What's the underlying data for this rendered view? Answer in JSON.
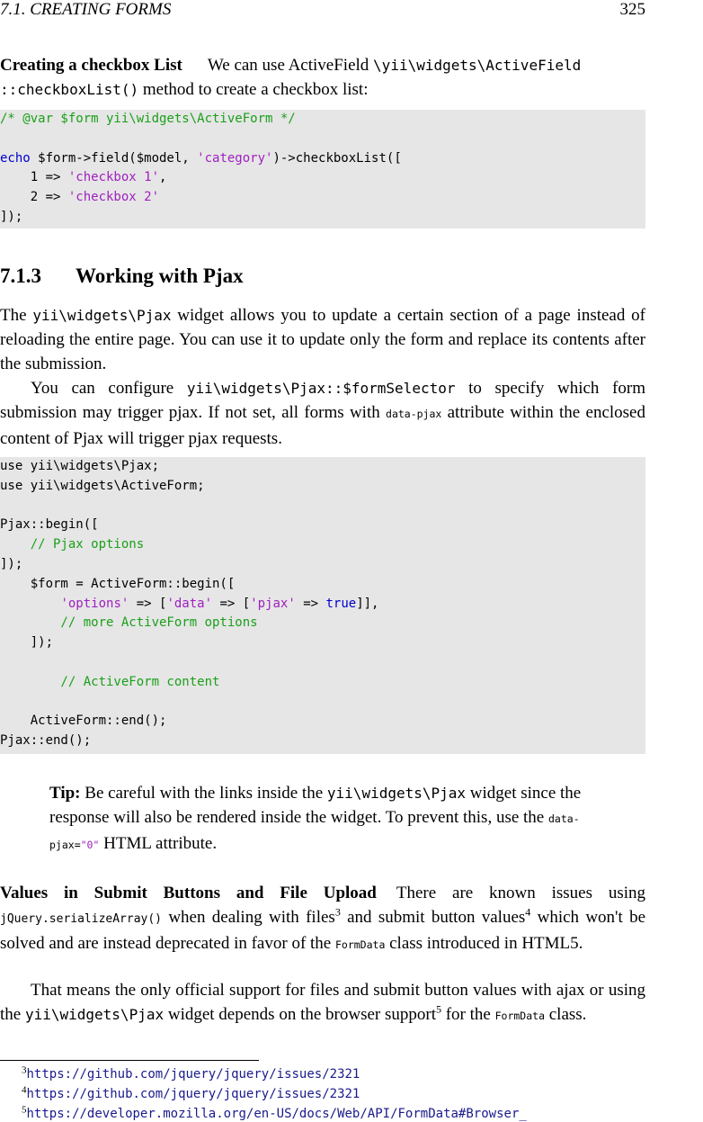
{
  "header": {
    "chapter": "7.1.   CREATING FORMS",
    "page_number": "325"
  },
  "section_checkbox": {
    "title": "Creating a checkbox List",
    "text_1": "We can use ActiveField ",
    "code_1": "\\yii\\widgets\\ActiveField",
    "code_2": "::checkboxList()",
    "text_2": " method to create a checkbox list:"
  },
  "code_block_1": {
    "lines": [
      {
        "parts": [
          {
            "t": "/* @var $form yii\\widgets\\ActiveForm */",
            "c": "cm"
          }
        ]
      },
      {
        "parts": [
          {
            "t": "",
            "c": ""
          }
        ]
      },
      {
        "parts": [
          {
            "t": "echo",
            "c": "kw"
          },
          {
            "t": " $form->field($model, ",
            "c": ""
          },
          {
            "t": "'category'",
            "c": "str"
          },
          {
            "t": ")->checkboxList([",
            "c": ""
          }
        ]
      },
      {
        "parts": [
          {
            "t": "    1 => ",
            "c": ""
          },
          {
            "t": "'checkbox 1'",
            "c": "str"
          },
          {
            "t": ",",
            "c": ""
          }
        ]
      },
      {
        "parts": [
          {
            "t": "    2 => ",
            "c": ""
          },
          {
            "t": "'checkbox 2'",
            "c": "str"
          }
        ]
      },
      {
        "parts": [
          {
            "t": "]);",
            "c": ""
          }
        ]
      }
    ]
  },
  "section_pjax": {
    "number": "7.1.3",
    "title": "Working with Pjax",
    "p1_a": "The ",
    "p1_code": "yii\\widgets\\Pjax",
    "p1_b": " widget allows you to update a certain section of a page instead of reloading the entire page. You can use it to update only the form and replace its contents after the submission.",
    "p2_a": "You can configure ",
    "p2_code": "yii\\widgets\\Pjax::$formSelector",
    "p2_b": " to specify which form submission may trigger pjax. If not set, all forms with ",
    "p2_code2": "data-pjax",
    "p2_c": " attribute within the enclosed content of Pjax will trigger pjax requests."
  },
  "code_block_2": {
    "lines": [
      {
        "parts": [
          {
            "t": "use yii\\widgets\\Pjax;",
            "c": ""
          }
        ]
      },
      {
        "parts": [
          {
            "t": "use yii\\widgets\\ActiveForm;",
            "c": ""
          }
        ]
      },
      {
        "parts": [
          {
            "t": "",
            "c": ""
          }
        ]
      },
      {
        "parts": [
          {
            "t": "Pjax::begin([",
            "c": ""
          }
        ]
      },
      {
        "parts": [
          {
            "t": "    // Pjax options",
            "c": "cm"
          }
        ]
      },
      {
        "parts": [
          {
            "t": "]);",
            "c": ""
          }
        ]
      },
      {
        "parts": [
          {
            "t": "    $form = ActiveForm::begin([",
            "c": ""
          }
        ]
      },
      {
        "parts": [
          {
            "t": "        ",
            "c": ""
          },
          {
            "t": "'options'",
            "c": "str"
          },
          {
            "t": " => [",
            "c": ""
          },
          {
            "t": "'data'",
            "c": "str"
          },
          {
            "t": " => [",
            "c": ""
          },
          {
            "t": "'pjax'",
            "c": "str"
          },
          {
            "t": " => ",
            "c": ""
          },
          {
            "t": "true",
            "c": "kw"
          },
          {
            "t": "]],",
            "c": ""
          }
        ]
      },
      {
        "parts": [
          {
            "t": "        // more ActiveForm options",
            "c": "cm"
          }
        ]
      },
      {
        "parts": [
          {
            "t": "    ]);",
            "c": ""
          }
        ]
      },
      {
        "parts": [
          {
            "t": "",
            "c": ""
          }
        ]
      },
      {
        "parts": [
          {
            "t": "        // ActiveForm content",
            "c": "cm"
          }
        ]
      },
      {
        "parts": [
          {
            "t": "",
            "c": ""
          }
        ]
      },
      {
        "parts": [
          {
            "t": "    ActiveForm::end();",
            "c": ""
          }
        ]
      },
      {
        "parts": [
          {
            "t": "Pjax::end();",
            "c": ""
          }
        ]
      }
    ]
  },
  "tip": {
    "label": "Tip:",
    "text_a": " Be careful with the links inside the ",
    "code": "yii\\widgets\\Pjax",
    "text_b": " widget since the response will also be rendered inside the widget. To prevent this, use the ",
    "code2": "data-pjax=",
    "code3": "\"0\"",
    "text_c": " HTML attribute."
  },
  "section_values": {
    "title": "Values in Submit Buttons and File Upload",
    "p1_a": "There are known issues using ",
    "p1_code": "jQuery.serializeArray()",
    "p1_b": " when dealing with files",
    "fn3": "3",
    "p1_c": " and submit button values",
    "fn4": "4",
    "p1_d": " which won't be solved and are instead deprecated in favor of the ",
    "p1_code2": "FormData",
    "p1_e": " class introduced in HTML5.",
    "p2_a": "That means the only official support for files and submit button values with ajax or using the ",
    "p2_code": "yii\\widgets\\Pjax",
    "p2_b": " widget depends on the browser support",
    "fn5": "5",
    "p2_c": " for the ",
    "p2_code2": "FormData",
    "p2_d": " class."
  },
  "footnotes": [
    {
      "num": "3",
      "url": "https://github.com/jquery/jquery/issues/2321"
    },
    {
      "num": "4",
      "url": "https://github.com/jquery/jquery/issues/2321"
    },
    {
      "num": "5",
      "url": "https://developer.mozilla.org/en-US/docs/Web/API/FormData#Browser_"
    }
  ]
}
